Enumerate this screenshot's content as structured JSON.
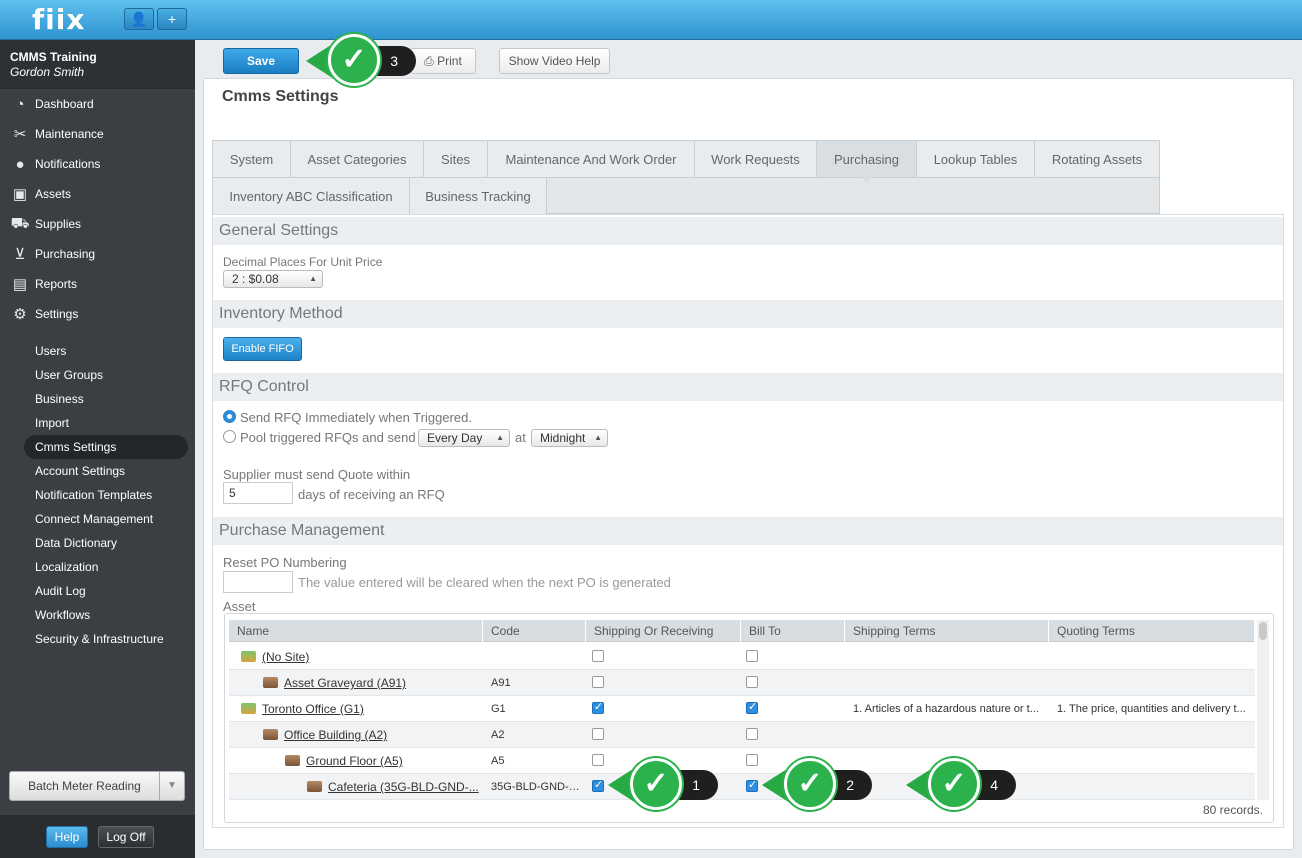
{
  "app": {
    "logo": "fiix",
    "user_icon": "user-icon",
    "add_icon": "plus-icon"
  },
  "user": {
    "org": "CMMS Training",
    "name": "Gordon Smith"
  },
  "nav": [
    {
      "label": "Dashboard",
      "icon": "dashboard-icon"
    },
    {
      "label": "Maintenance",
      "icon": "wrench-icon"
    },
    {
      "label": "Notifications",
      "icon": "speech-bubble-icon"
    },
    {
      "label": "Assets",
      "icon": "box-icon"
    },
    {
      "label": "Supplies",
      "icon": "truck-icon"
    },
    {
      "label": "Purchasing",
      "icon": "cart-icon"
    },
    {
      "label": "Reports",
      "icon": "chart-icon"
    },
    {
      "label": "Settings",
      "icon": "gear-icon"
    }
  ],
  "settings_sub": [
    "Users",
    "User Groups",
    "Business",
    "Import",
    "Cmms Settings",
    "Account Settings",
    "Notification Templates",
    "Connect Management",
    "Data Dictionary",
    "Localization",
    "Audit Log",
    "Workflows",
    "Security & Infrastructure"
  ],
  "sidebar_footer": {
    "batch": "Batch Meter Reading",
    "help": "Help",
    "logoff": "Log Off"
  },
  "toolbar": {
    "save": "Save",
    "print": "Print",
    "video_help": "Show Video Help"
  },
  "page_title": "Cmms Settings",
  "tabs": [
    "System",
    "Asset Categories",
    "Sites",
    "Maintenance And Work Order",
    "Work Requests",
    "Purchasing",
    "Lookup Tables",
    "Rotating Assets",
    "Inventory ABC Classification",
    "Business Tracking"
  ],
  "active_tab": "Purchasing",
  "general": {
    "heading": "General Settings",
    "decimal_label": "Decimal Places For Unit Price",
    "decimal_value": "2 : $0.08"
  },
  "inventory": {
    "heading": "Inventory Method",
    "fifo_btn": "Enable FIFO"
  },
  "rfq": {
    "heading": "RFQ Control",
    "opt_immediate": "Send RFQ Immediately when Triggered.",
    "opt_pool": "Pool triggered RFQs and send",
    "freq": "Every Day",
    "at": "at",
    "time": "Midnight",
    "quote_label": "Supplier must send Quote within",
    "quote_days": "5",
    "quote_suffix": "days of receiving an RFQ"
  },
  "purchase": {
    "heading": "Purchase Management",
    "reset_label": "Reset PO Numbering",
    "reset_hint": "The value entered will be cleared when the next PO is generated",
    "asset_label": "Asset"
  },
  "grid": {
    "columns": [
      "Name",
      "Code",
      "Shipping Or Receiving",
      "Bill To",
      "Shipping Terms",
      "Quoting Terms"
    ],
    "rows": [
      {
        "name": "(No Site)",
        "code": "",
        "ship": false,
        "bill": false,
        "sterms": "",
        "qterms": "",
        "indent": 0,
        "kind": "site"
      },
      {
        "name": "Asset Graveyard (A91)",
        "code": "A91",
        "ship": false,
        "bill": false,
        "sterms": "",
        "qterms": "",
        "indent": 1,
        "kind": "bldg"
      },
      {
        "name": "Toronto Office (G1)",
        "code": "G1",
        "ship": true,
        "bill": true,
        "sterms": "1. Articles of a hazardous nature or t...",
        "qterms": "1. The price, quantities and delivery t...",
        "indent": 0,
        "kind": "site"
      },
      {
        "name": "Office Building (A2)",
        "code": "A2",
        "ship": false,
        "bill": false,
        "sterms": "",
        "qterms": "",
        "indent": 1,
        "kind": "bldg"
      },
      {
        "name": "Ground Floor (A5)",
        "code": "A5",
        "ship": false,
        "bill": false,
        "sterms": "",
        "qterms": "",
        "indent": 2,
        "kind": "bldg"
      },
      {
        "name": "Cafeteria (35G-BLD-GND-...",
        "code": "35G-BLD-GND-C...",
        "ship": true,
        "bill": true,
        "sterms": "",
        "qterms": "",
        "indent": 3,
        "kind": "bldg"
      }
    ],
    "records": "80 records."
  },
  "callouts": [
    {
      "num": "1",
      "icon": "checkmark-icon"
    },
    {
      "num": "2",
      "icon": "checkmark-icon"
    },
    {
      "num": "3",
      "icon": "checkmark-icon"
    },
    {
      "num": "4",
      "icon": "checkmark-icon"
    }
  ],
  "colors": {
    "accent": "#2a8dd0",
    "callout_green": "#2bb24c",
    "sidebar": "#3b3f43"
  }
}
